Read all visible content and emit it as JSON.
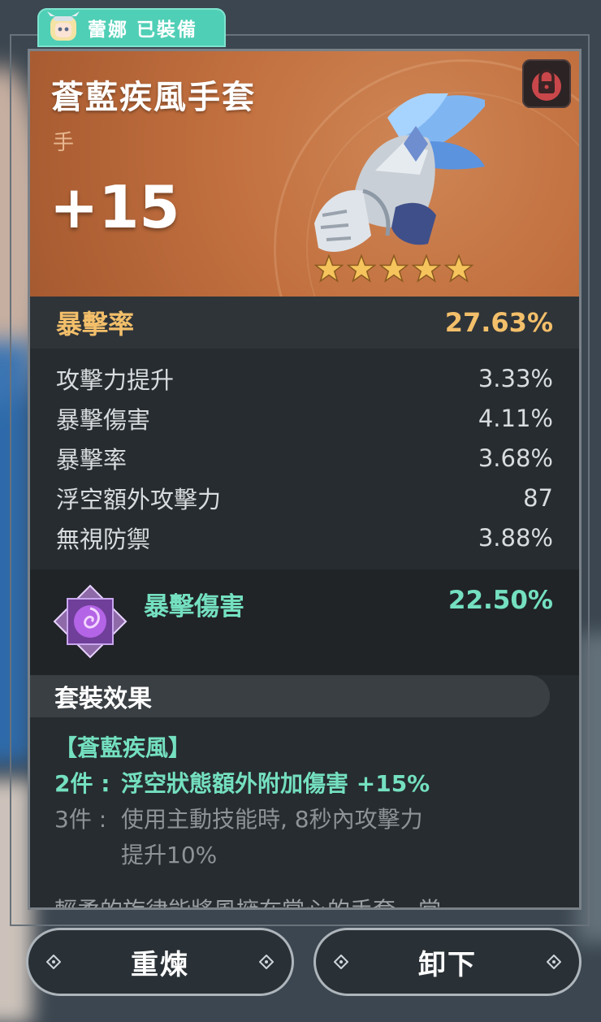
{
  "equipped_tag": {
    "label": "蕾娜 已裝備"
  },
  "item": {
    "name": "蒼藍疾風手套",
    "slot": "手",
    "level": "+15",
    "rarity_stars": 5
  },
  "main_stat": {
    "name": "暴擊率",
    "value": "27.63%"
  },
  "sub_stats": [
    {
      "name": "攻擊力提升",
      "value": "3.33%"
    },
    {
      "name": "暴擊傷害",
      "value": "4.11%"
    },
    {
      "name": "暴擊率",
      "value": "3.68%"
    },
    {
      "name": "浮空額外攻擊力",
      "value": "87"
    },
    {
      "name": "無視防禦",
      "value": "3.88%"
    }
  ],
  "rune_stat": {
    "name": "暴擊傷害",
    "value": "22.50%"
  },
  "set_effect": {
    "header": "套裝效果",
    "set_name": "【蒼藍疾風】",
    "two_piece": {
      "count": "2件 :",
      "text": "浮空狀態額外附加傷害 +15%"
    },
    "three_piece": {
      "count": "3件 :",
      "text_line1": "使用主動技能時, 8秒內攻擊力",
      "text_line2": "提升10%"
    }
  },
  "flavor_text": "輕柔的旋律能將風擁在掌心的手套，當",
  "buttons": {
    "refine": "重煉",
    "unequip": "卸下"
  },
  "colors": {
    "accent_teal": "#74e0bf",
    "main_stat_gold": "#f3bf6a",
    "header_orange": "#c2703f"
  },
  "icons": [
    "lock-icon",
    "gauntlet-icon",
    "star-icon",
    "rune-icon",
    "diamond-icon"
  ]
}
